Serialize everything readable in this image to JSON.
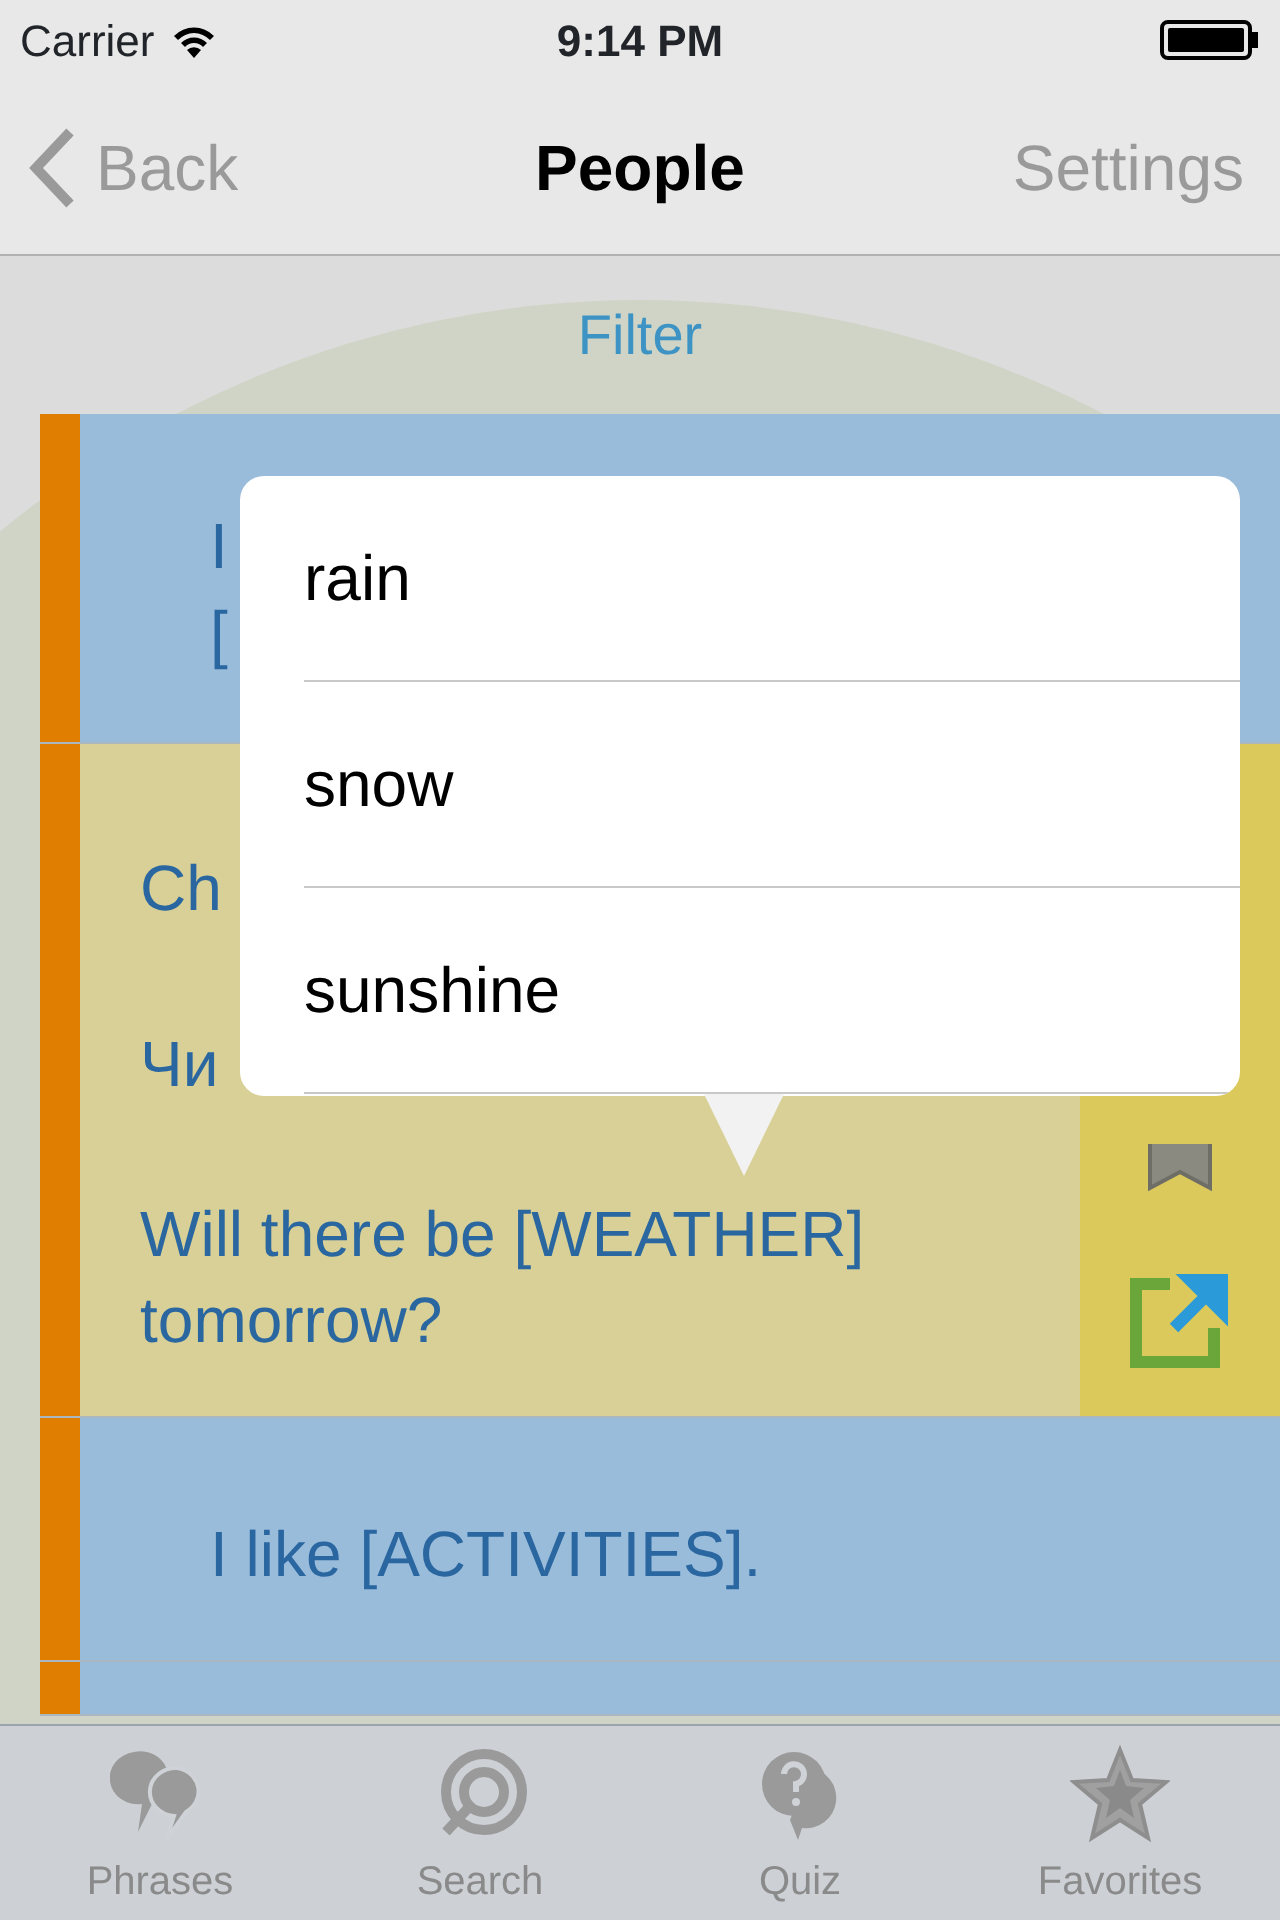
{
  "status_bar": {
    "carrier": "Carrier",
    "time": "9:14 PM"
  },
  "nav_bar": {
    "back": "Back",
    "title": "People",
    "settings": "Settings"
  },
  "filter": "Filter",
  "rows": [
    {
      "kind": "plain",
      "color": "#99bcdb",
      "lines": [
        "I",
        "["
      ]
    },
    {
      "kind": "detail",
      "color": "#d8d096",
      "lines": [
        "Ch",
        "Чи",
        "Will there be [WEATHER] tomorrow?"
      ]
    },
    {
      "kind": "plain",
      "color": "#99bcdb",
      "lines": [
        "I like [ACTIVITIES]."
      ]
    },
    {
      "kind": "plain",
      "color": "#99bcdb",
      "lines": []
    }
  ],
  "popover": {
    "options": [
      {
        "label": "rain",
        "selected": false
      },
      {
        "label": "snow",
        "selected": false
      },
      {
        "label": "sunshine",
        "selected": false
      }
    ]
  },
  "tab_bar": [
    {
      "label": "Phrases",
      "kind": "phrases",
      "selected": false
    },
    {
      "label": "Search",
      "kind": "search",
      "selected": false
    },
    {
      "label": "Quiz",
      "kind": "quiz",
      "selected": false
    },
    {
      "label": "Favorites",
      "kind": "favorites",
      "selected": false
    }
  ]
}
